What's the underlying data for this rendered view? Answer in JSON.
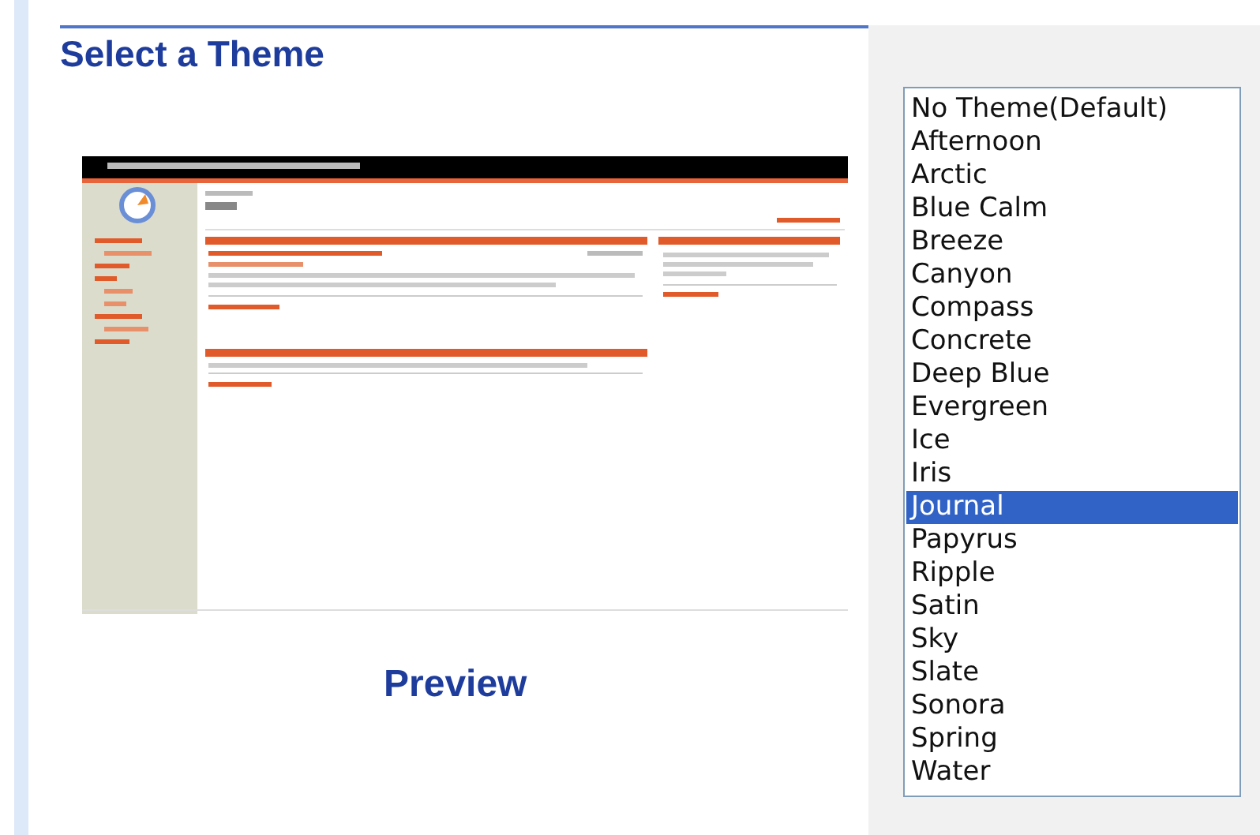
{
  "title": "Select a Theme",
  "preview_label": "Preview",
  "themes": [
    {
      "label": "No Theme(Default)",
      "selected": false
    },
    {
      "label": "Afternoon",
      "selected": false
    },
    {
      "label": "Arctic",
      "selected": false
    },
    {
      "label": "Blue Calm",
      "selected": false
    },
    {
      "label": "Breeze",
      "selected": false
    },
    {
      "label": "Canyon",
      "selected": false
    },
    {
      "label": "Compass",
      "selected": false
    },
    {
      "label": "Concrete",
      "selected": false
    },
    {
      "label": "Deep Blue",
      "selected": false
    },
    {
      "label": "Evergreen",
      "selected": false
    },
    {
      "label": "Ice",
      "selected": false
    },
    {
      "label": "Iris",
      "selected": false
    },
    {
      "label": "Journal",
      "selected": true
    },
    {
      "label": "Papyrus",
      "selected": false
    },
    {
      "label": "Ripple",
      "selected": false
    },
    {
      "label": "Satin",
      "selected": false
    },
    {
      "label": "Sky",
      "selected": false
    },
    {
      "label": "Slate",
      "selected": false
    },
    {
      "label": "Sonora",
      "selected": false
    },
    {
      "label": "Spring",
      "selected": false
    },
    {
      "label": "Water",
      "selected": false
    }
  ]
}
